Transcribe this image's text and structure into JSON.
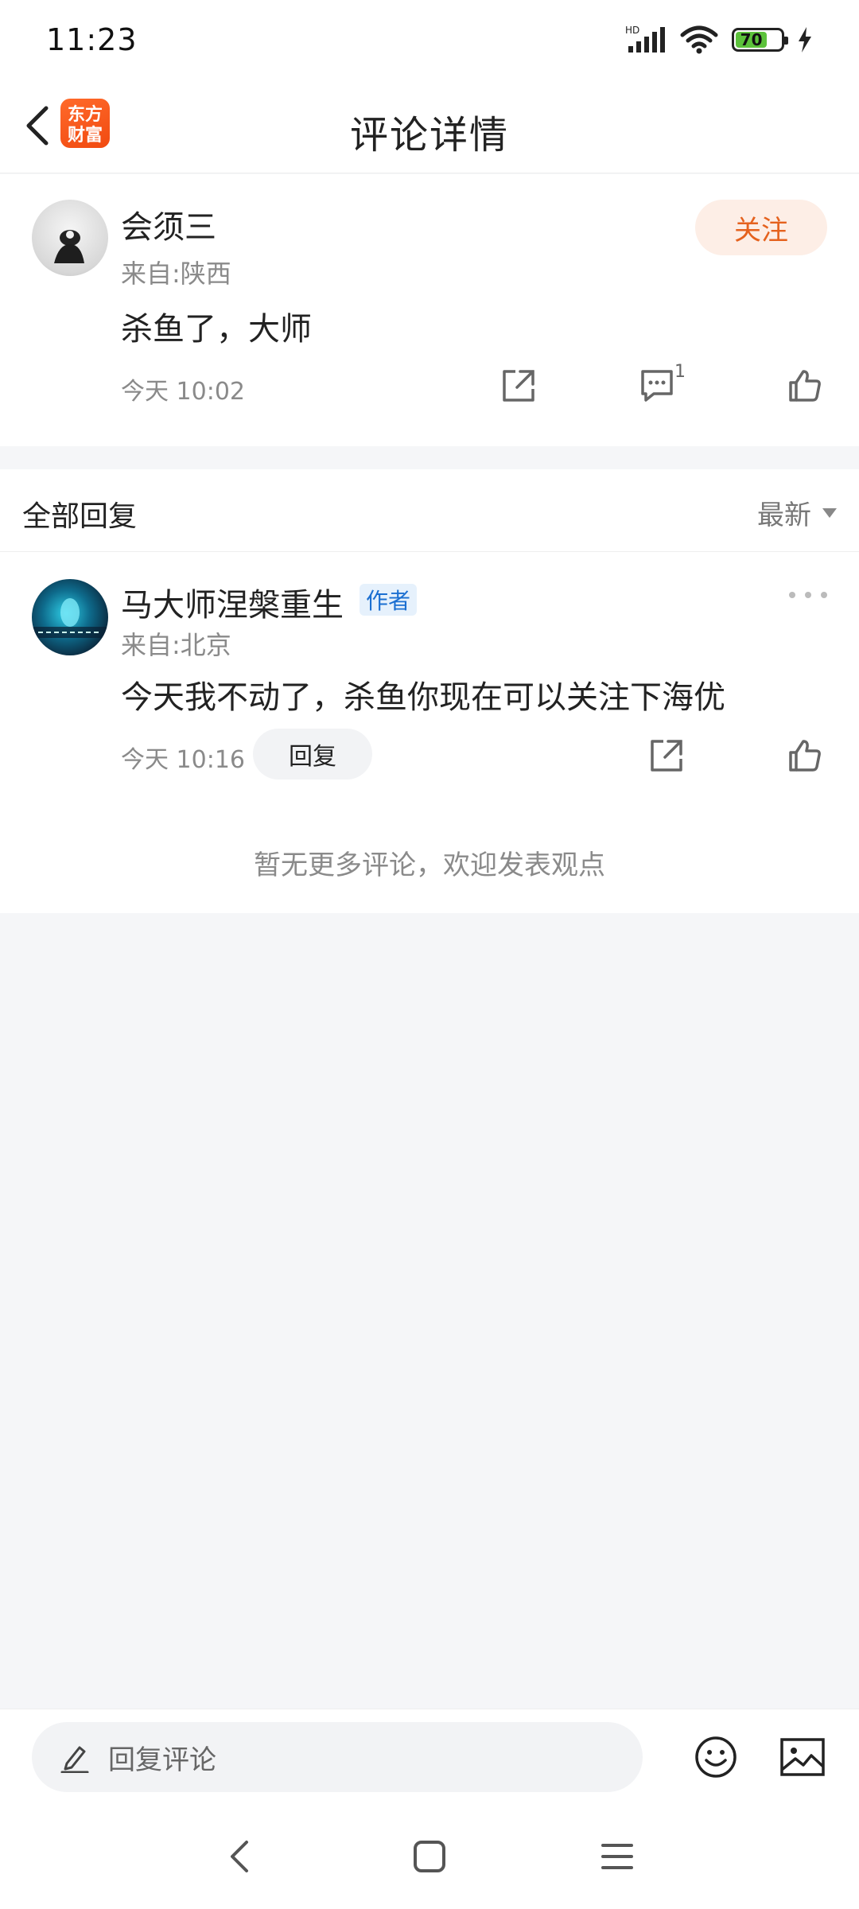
{
  "status_bar": {
    "time": "11:23",
    "network_label": "HD",
    "battery_level": 70,
    "battery_text": "70",
    "charging": true
  },
  "header": {
    "title": "评论详情",
    "logo_line1": "东方",
    "logo_line2": "财富"
  },
  "main_comment": {
    "user_name": "会须三",
    "location": "来自:陕西",
    "text": "杀鱼了，大师",
    "time": "今天 10:02",
    "follow_label": "关注",
    "reply_count": "1"
  },
  "replies_section": {
    "title": "全部回复",
    "sort_label": "最新"
  },
  "replies": [
    {
      "user_name": "马大师涅槃重生",
      "badge": "作者",
      "location": "来自:北京",
      "text": "今天我不动了，杀鱼你现在可以关注下海优",
      "time": "今天 10:16",
      "reply_label": "回复"
    }
  ],
  "no_more_text": "暂无更多评论，欢迎发表观点",
  "input_bar": {
    "placeholder": "回复评论"
  },
  "colors": {
    "accent_orange": "#e5621e",
    "follow_bg": "#fdeee6",
    "author_badge_blue": "#1b6fd1",
    "page_bg": "#f5f6f8"
  }
}
